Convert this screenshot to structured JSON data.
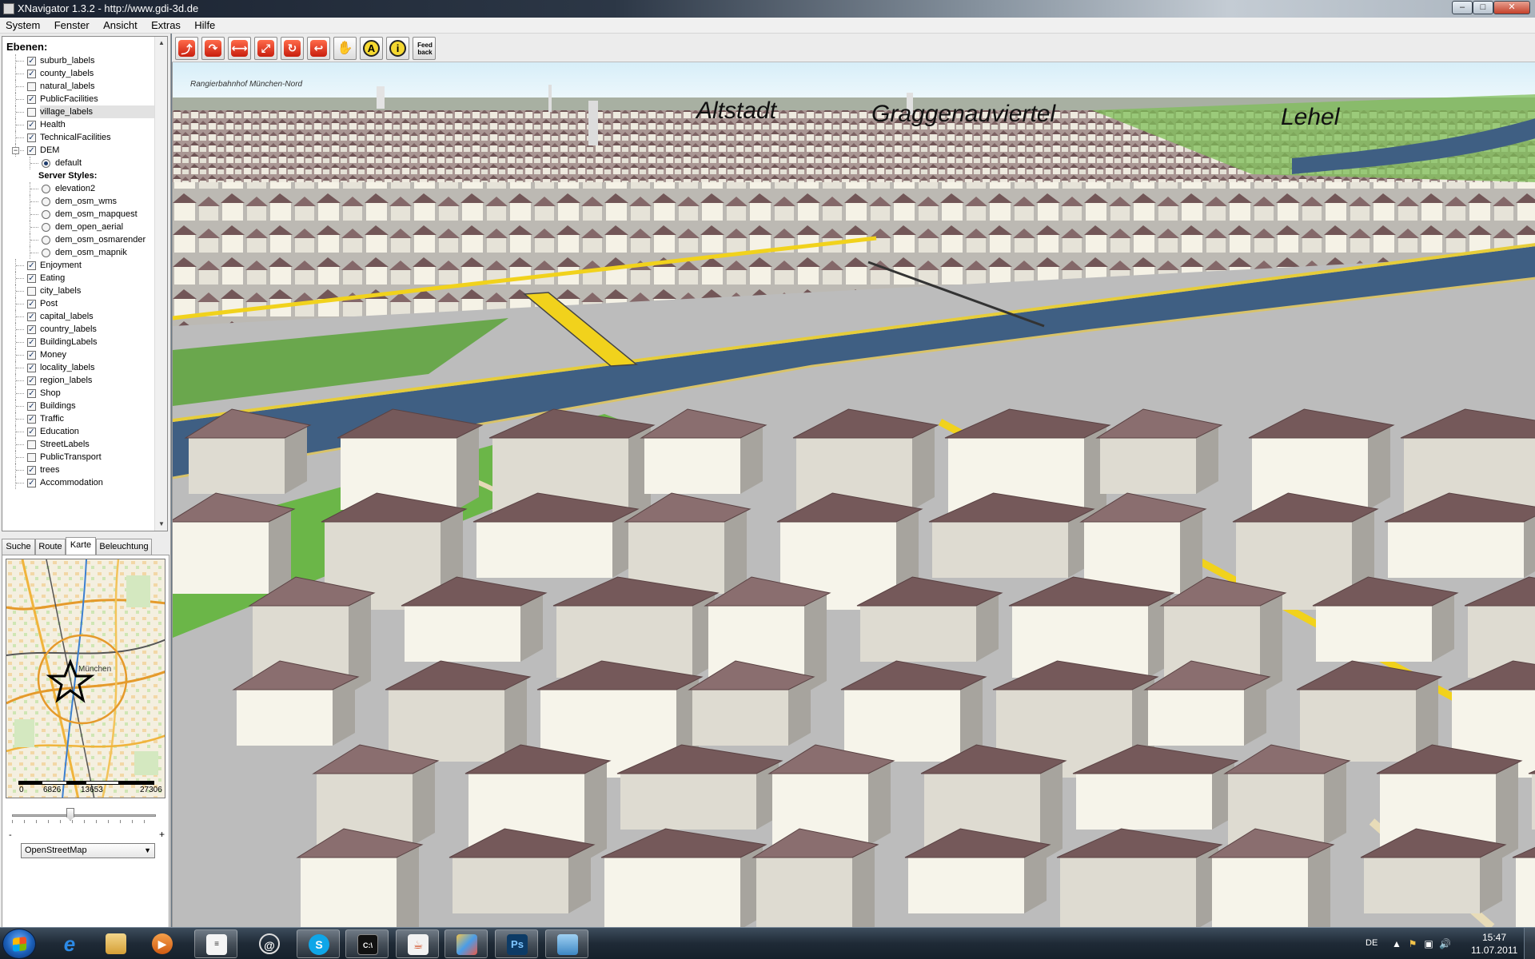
{
  "window": {
    "title": "XNavigator 1.3.2 - http://www.gdi-3d.de"
  },
  "menu": [
    "System",
    "Fenster",
    "Ansicht",
    "Extras",
    "Hilfe"
  ],
  "layers": {
    "heading": "Ebenen:",
    "items": [
      {
        "label": "suburb_labels",
        "checked": true
      },
      {
        "label": "county_labels",
        "checked": true
      },
      {
        "label": "natural_labels",
        "checked": false
      },
      {
        "label": "PublicFacilities",
        "checked": true
      },
      {
        "label": "village_labels",
        "checked": false,
        "selected": true
      },
      {
        "label": "Health",
        "checked": true
      },
      {
        "label": "TechnicalFacilities",
        "checked": true
      },
      {
        "label": "DEM",
        "checked": true,
        "expanded": true
      }
    ],
    "dem_children": {
      "default_style": "default",
      "server_styles_heading": "Server Styles:",
      "styles": [
        "elevation2",
        "dem_osm_wms",
        "dem_osm_mapquest",
        "dem_open_aerial",
        "dem_osm_osmarender",
        "dem_osm_mapnik"
      ]
    },
    "items_after": [
      {
        "label": "Enjoyment",
        "checked": true
      },
      {
        "label": "Eating",
        "checked": true
      },
      {
        "label": "city_labels",
        "checked": false
      },
      {
        "label": "Post",
        "checked": true
      },
      {
        "label": "capital_labels",
        "checked": true
      },
      {
        "label": "country_labels",
        "checked": true
      },
      {
        "label": "BuildingLabels",
        "checked": true
      },
      {
        "label": "Money",
        "checked": true
      },
      {
        "label": "locality_labels",
        "checked": true
      },
      {
        "label": "region_labels",
        "checked": true
      },
      {
        "label": "Shop",
        "checked": true
      },
      {
        "label": "Buildings",
        "checked": true
      },
      {
        "label": "Traffic",
        "checked": true
      },
      {
        "label": "Education",
        "checked": true
      },
      {
        "label": "StreetLabels",
        "checked": false
      },
      {
        "label": "PublicTransport",
        "checked": false
      },
      {
        "label": "trees",
        "checked": true
      },
      {
        "label": "Accommodation",
        "checked": true
      }
    ]
  },
  "tabs": [
    {
      "label": "Suche",
      "active": false
    },
    {
      "label": "Route",
      "active": false
    },
    {
      "label": "Karte",
      "active": true
    },
    {
      "label": "Beleuchtung",
      "active": false
    }
  ],
  "minimap": {
    "city_label": "München",
    "scale_labels": [
      "0",
      "6826",
      "13653",
      "27306"
    ],
    "zoom_minus": "-",
    "zoom_plus": "+",
    "zoom_level": 0.4,
    "map_source": "OpenStreetMap"
  },
  "toolbar": {
    "buttons": [
      {
        "name": "move-forward",
        "icon": "red-arrow-forward-icon"
      },
      {
        "name": "turn",
        "icon": "red-arrow-turn-icon"
      },
      {
        "name": "move-horizontal",
        "icon": "red-arrows-horizontal-icon"
      },
      {
        "name": "move-vertical",
        "icon": "red-arrows-vertical-icon"
      },
      {
        "name": "rotate",
        "icon": "red-rotate-icon"
      },
      {
        "name": "return",
        "icon": "red-return-icon"
      },
      {
        "name": "pan",
        "icon": "hand-icon"
      },
      {
        "name": "annotation",
        "icon": "letter-a-icon"
      },
      {
        "name": "info",
        "icon": "info-icon"
      },
      {
        "name": "feedback",
        "icon": "feedback-icon"
      }
    ],
    "annotation_glyph": "A",
    "info_glyph": "i",
    "feedback_text": "Feed back"
  },
  "view": {
    "labels": {
      "rangier": "Rangierbahnhof München-Nord",
      "altstadt": "Altstadt",
      "graggenau": "Graggenauviertel",
      "lehel": "Lehel"
    },
    "colors": {
      "sky_top": "#e9f5fb",
      "ground": "#bcbcbc",
      "water": "#3f5f83",
      "grass": "#6bb648",
      "road": "#f1d21c",
      "roof": "#75595a",
      "wall": "#f6f4ea"
    }
  },
  "taskbar": {
    "lang": "DE",
    "time": "15:47",
    "date": "11.07.2011"
  }
}
